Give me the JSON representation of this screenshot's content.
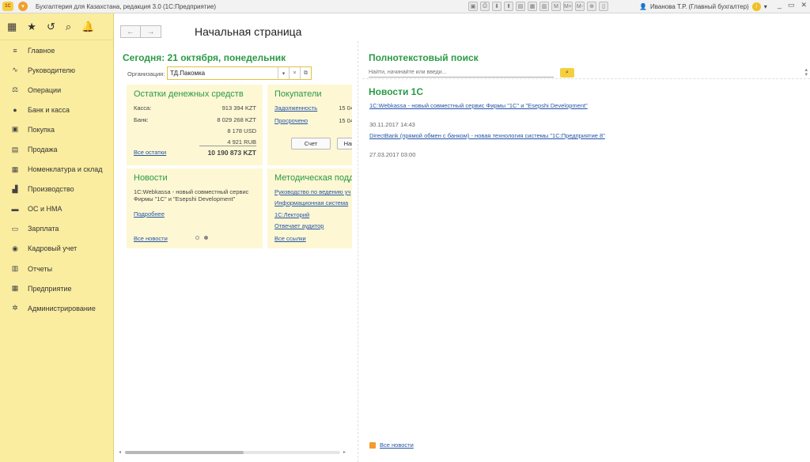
{
  "titlebar": {
    "logo_text": "1С",
    "title": "Бухгалтерия для Казахстана, редакция 3.0  (1С:Предприятие)",
    "user": "Иванова Т.Р. (Главный бухгалтер)",
    "tools": [
      "▣",
      "⎙",
      "⬇",
      "⬆",
      "▤",
      "▦",
      "▥",
      "M",
      "M+",
      "M-",
      "⊕",
      "▯"
    ],
    "window_controls": [
      "_",
      "▭",
      "✕"
    ]
  },
  "sidebar": {
    "top_icons": [
      "▦",
      "★",
      "↺",
      "⌕",
      "🔔"
    ],
    "items": [
      {
        "icon": "≡",
        "label": "Главное"
      },
      {
        "icon": "∿",
        "label": "Руководителю"
      },
      {
        "icon": "⚖",
        "label": "Операции"
      },
      {
        "icon": "●",
        "label": "Банк и касса"
      },
      {
        "icon": "▣",
        "label": "Покупка"
      },
      {
        "icon": "▤",
        "label": "Продажа"
      },
      {
        "icon": "▦",
        "label": "Номенклатура и склад"
      },
      {
        "icon": "▟",
        "label": "Производство"
      },
      {
        "icon": "▬",
        "label": "ОС и НМА"
      },
      {
        "icon": "▭",
        "label": "Зарплата"
      },
      {
        "icon": "◉",
        "label": "Кадровый учет"
      },
      {
        "icon": "▥",
        "label": "Отчеты"
      },
      {
        "icon": "▦",
        "label": "Предприятие"
      },
      {
        "icon": "✲",
        "label": "Администрирование"
      }
    ]
  },
  "toolbar": {
    "back": "←",
    "forward": "→"
  },
  "page": {
    "title": "Начальная страница"
  },
  "left": {
    "date_heading": "Сегодня: 21 октября, понедельник",
    "org_label": "Организация:",
    "org_value": "ТД.Пакомка",
    "org_btn_dropdown": "▾",
    "org_btn_clear": "×",
    "org_btn_open": "⧉",
    "cash_card": {
      "title": "Остатки денежных средств",
      "rows": [
        {
          "label": "Касса:",
          "value": "913 394 KZT"
        },
        {
          "label": "Банк:",
          "value": "8 029 268 KZT"
        },
        {
          "label": "",
          "value": "8 178 USD"
        },
        {
          "label": "",
          "value": "4 921 RUB"
        }
      ],
      "all_link": "Все остатки",
      "total": "10 190 873 KZT"
    },
    "buyers_card": {
      "title": "Покупатели",
      "rows": [
        {
          "label": "Задолженность",
          "value": "15 04"
        },
        {
          "label": "Просрочено",
          "value": "15 04"
        }
      ],
      "btn_invoice": "Счет",
      "btn_next": "Нак"
    },
    "news_card": {
      "title": "Новости",
      "text": "1С:Webkassa - новый совместный сервис Фирмы \"1С\" и \"Esepshi Development\"",
      "more_link": "Подробнее",
      "all_link": "Все новости"
    },
    "support_card": {
      "title": "Методическая подд",
      "links": [
        "Руководство по ведению уч",
        "Информационная система",
        "1С:Лекторий",
        "Отвечает аудитор"
      ],
      "all_link": "Все ссылки"
    }
  },
  "right": {
    "fulltext_heading": "Полнотекстовый поиск",
    "search_placeholder": "Найти, начинайте или введи...",
    "news_heading": "Новости 1С",
    "news": [
      {
        "title": "1С:Webkassa - новый совместный сервис Фирмы \"1С\" и \"Esepshi Development\"",
        "date": "30.11.2017 14:43"
      },
      {
        "title": "DirectBank (прямой обмен с банком) - новая технология системы \"1С:Предприятие 8\"",
        "date": "27.03.2017 03:00"
      }
    ],
    "all_news": "Все новости"
  }
}
